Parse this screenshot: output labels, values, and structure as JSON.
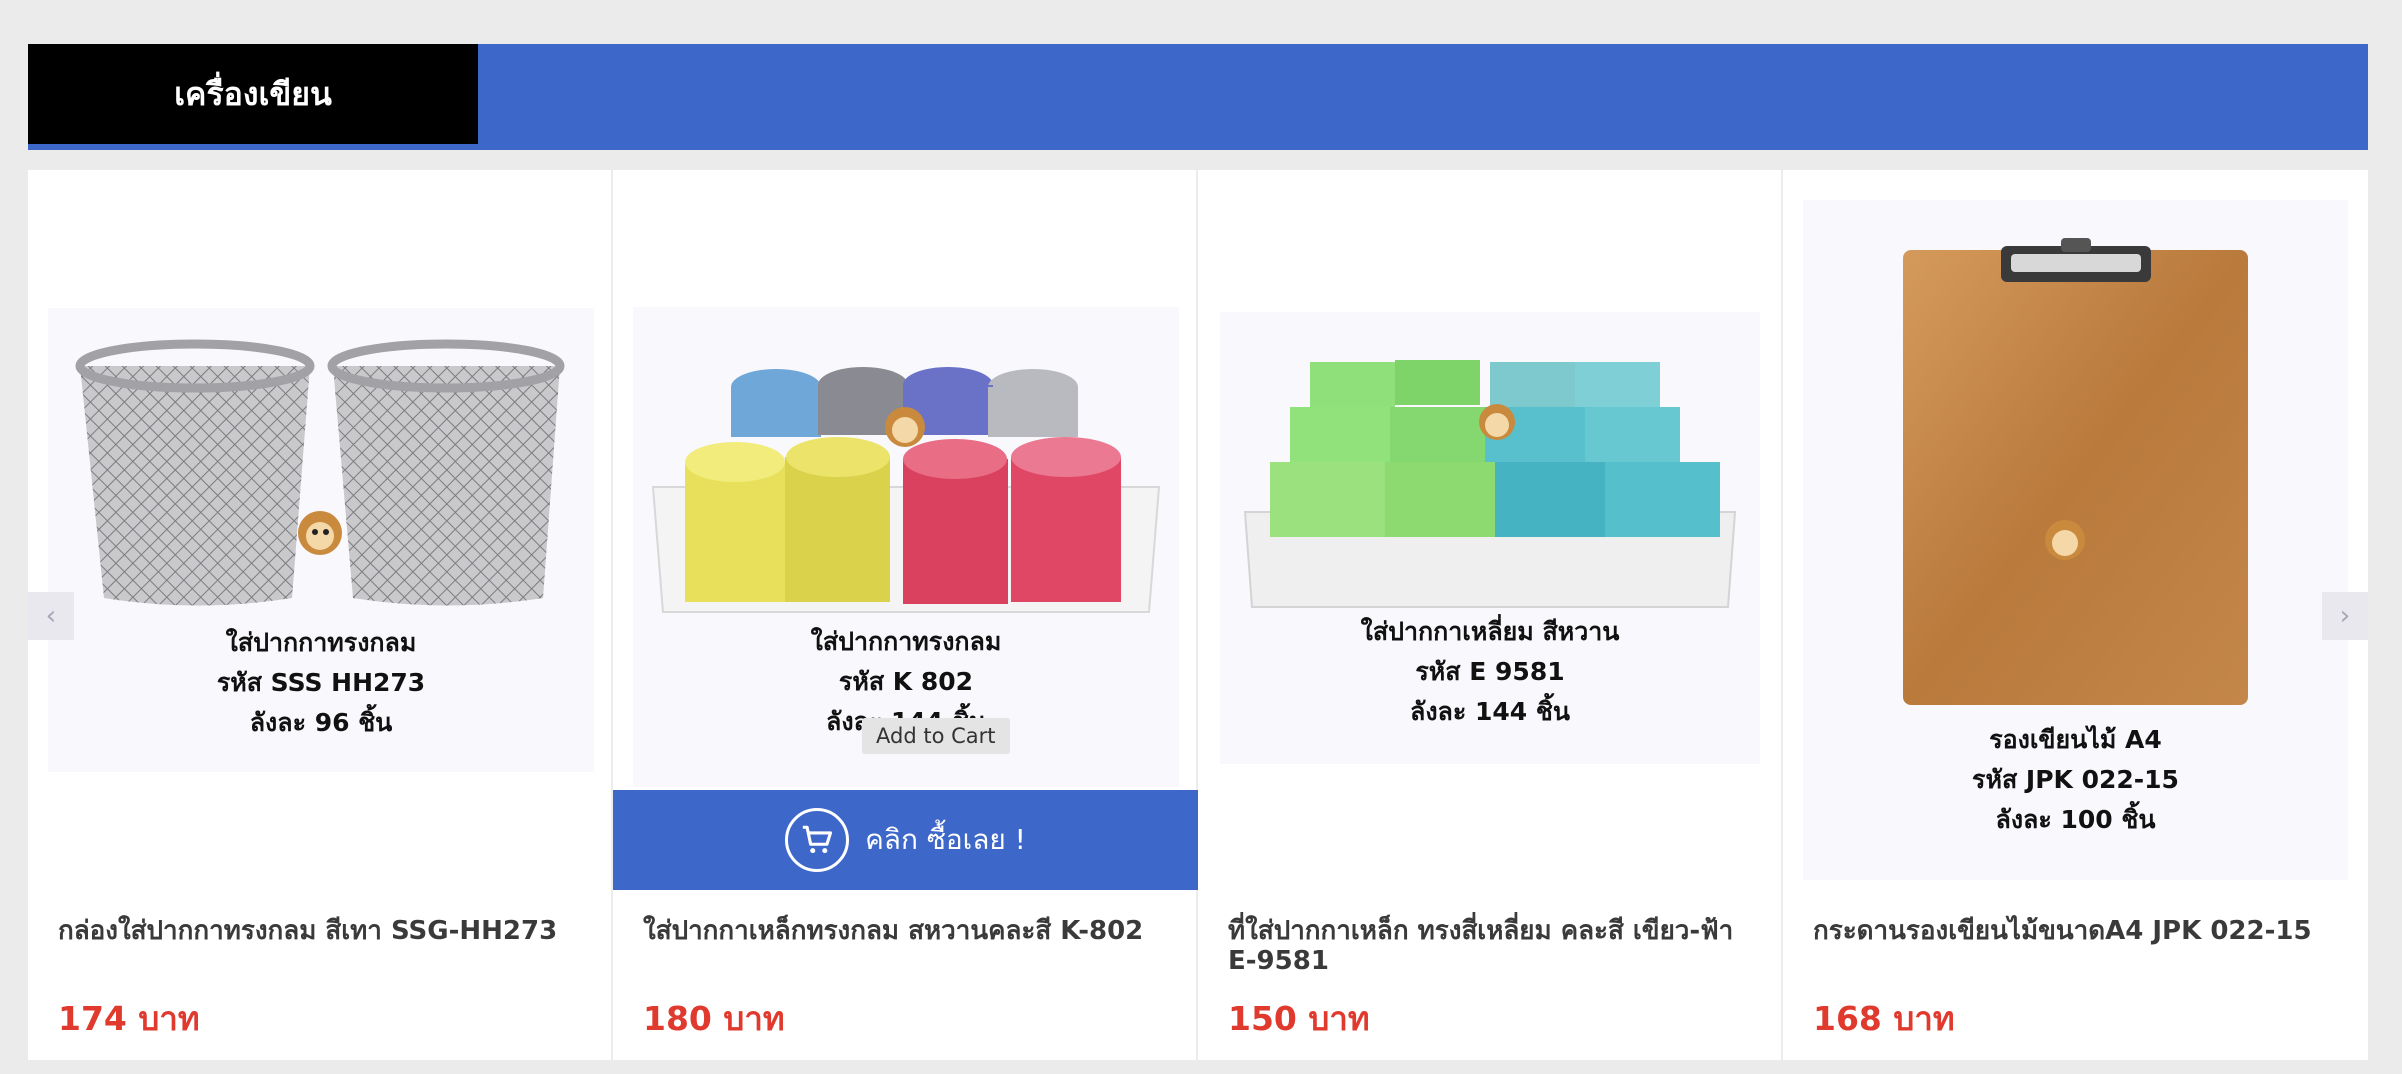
{
  "section": {
    "title": "เครื่องเขียน"
  },
  "colors": {
    "header_bar": "#3d67c8",
    "tab": "#000000",
    "price": "#e03a2e"
  },
  "products": [
    {
      "caption": [
        "ใส่ปากกาทรงกลม",
        "รหัส SSS HH273",
        "ลังละ 96 ชิ้น"
      ],
      "name": "กล่องใส่ปากกาทรงกลม สีเทา SSG-HH273",
      "price": "174 บาท"
    },
    {
      "caption": [
        "ใส่ปากกาทรงกลม",
        "รหัส K 802",
        "ลังละ 144 ชิ้น"
      ],
      "name": "ใส่ปากกาเหล็กทรงกลม สหวานคละสี K-802",
      "price": "180 บาท"
    },
    {
      "caption": [
        "ใส่ปากกาเหลี่ยม สีหวาน",
        "รหัส E 9581",
        "ลังละ 144 ชิ้น"
      ],
      "name": "ที่ใส่ปากกาเหล็ก ทรงสี่เหลี่ยม คละสี เขียว-ฟ้า E-9581",
      "price": "150 บาท"
    },
    {
      "caption": [
        "รองเขียนไม้ A4",
        "รหัส JPK 022-15",
        "ลังละ 100 ชิ้น"
      ],
      "name": "กระดานรองเขียนไม้ขนาดA4 JPK 022-15",
      "price": "168 บาท"
    }
  ],
  "cart_overlay": {
    "label": "คลิก ซื้อเลย !",
    "icon": "cart-icon"
  },
  "tooltip": "Add to Cart",
  "nav": {
    "prev_icon": "chevron-left-icon",
    "next_icon": "chevron-right-icon"
  }
}
